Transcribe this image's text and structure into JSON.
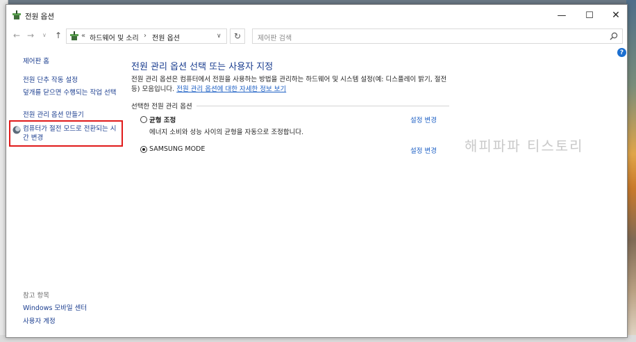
{
  "window": {
    "title": "전원 옵션",
    "controls": {
      "minimize": "—",
      "maximize": "☐",
      "close": "✕"
    }
  },
  "nav": {
    "back": "←",
    "forward": "→",
    "recent": "∨",
    "up": "↑",
    "breadcrumb_sep": "«",
    "breadcrumb": [
      "하드웨어 및 소리",
      "전원 옵션"
    ],
    "crumb_sep": "›",
    "dropdown": "∨",
    "refresh": "↻",
    "search_placeholder": "제어판 검색"
  },
  "help": "?",
  "sidebar": {
    "home": "제어판 홈",
    "items": [
      "전원 단추 작동 설정",
      "덮개를 닫으면 수행되는 작업 선택",
      "전원 관리 옵션 만들기",
      "컴퓨터가 절전 모드로 전환되는 시간 변경"
    ],
    "see_also_label": "참고 항목",
    "see_also": [
      "Windows 모바일 센터",
      "사용자 계정"
    ]
  },
  "main": {
    "title": "전원 관리 옵션 선택 또는 사용자 지정",
    "description": "전원 관리 옵션은 컴퓨터에서 전원을 사용하는 방법을 관리하는 하드웨어 및 시스템 설정(예: 디스플레이 밝기, 절전 등) 모음입니다. ",
    "description_link": "전원 관리 옵션에 대한 자세한 정보 보기",
    "section_label": "선택한 전원 관리 옵션",
    "plans": [
      {
        "name": "균형 조정",
        "description": "에너지 소비와 성능 사이의 균형을 자동으로 조정합니다.",
        "selected": false,
        "change_label": "설정 변경"
      },
      {
        "name": "SAMSUNG MODE",
        "description": "",
        "selected": true,
        "change_label": "설정 변경"
      }
    ]
  },
  "watermark": "해피파파 티스토리",
  "colors": {
    "link": "#1c5fc4",
    "title": "#1a3d8f",
    "highlight": "#e01919"
  }
}
